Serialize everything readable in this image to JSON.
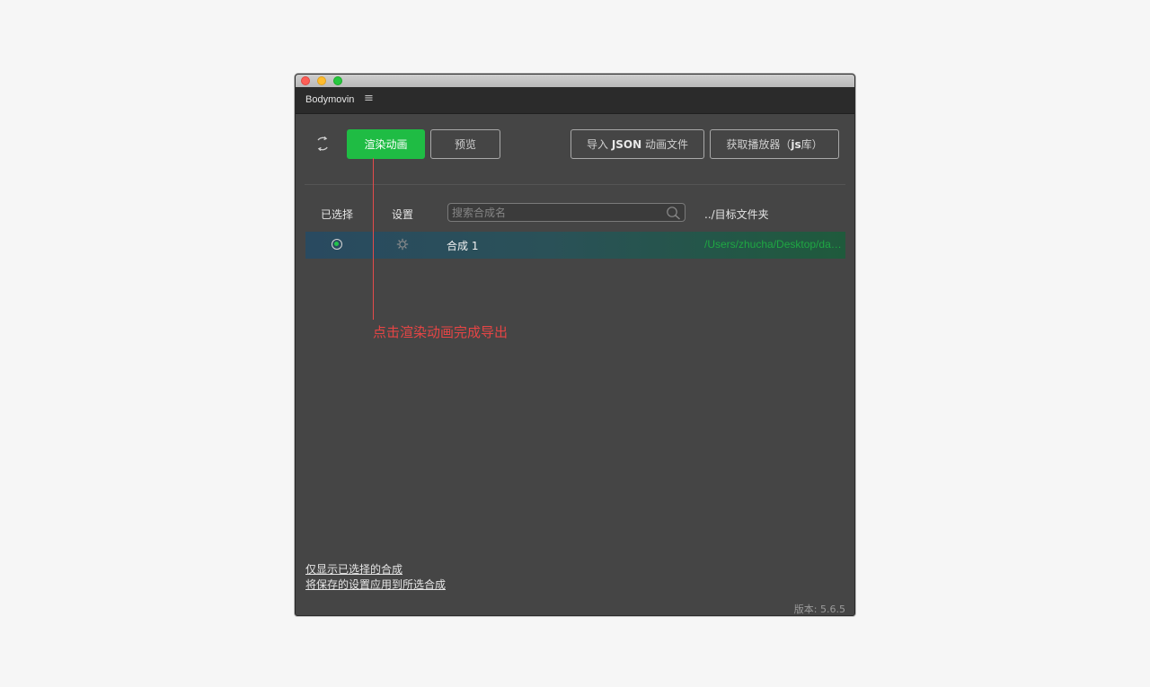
{
  "window": {
    "panel_title": "Bodymovin",
    "menu_icon": "hamburger-icon"
  },
  "toolbar": {
    "render_label": "渲染动画",
    "preview_label": "预览",
    "import_prefix": "导入 ",
    "import_bold": "JSON",
    "import_suffix": " 动画文件",
    "player_prefix": "获取播放器（",
    "player_bold": "js",
    "player_suffix": "库）",
    "refresh_icon": "refresh-icon"
  },
  "table": {
    "header_selected": "已选择",
    "header_settings": "设置",
    "search_placeholder": "搜索合成名",
    "header_destination": "../目标文件夹",
    "rows": [
      {
        "name": "合成 1",
        "path": "/Users/zhucha/Desktop/data.json",
        "selected": true
      }
    ]
  },
  "annotation": {
    "text": "点击渲染动画完成导出"
  },
  "footer": {
    "show_selected_label": "仅显示已选择的合成",
    "apply_settings_label": "将保存的设置应用到所选合成",
    "version": "版本: 5.6.5"
  },
  "colors": {
    "accent_green": "#1fbc44",
    "annotation_red": "#e64545",
    "panel_bg": "#454545"
  }
}
